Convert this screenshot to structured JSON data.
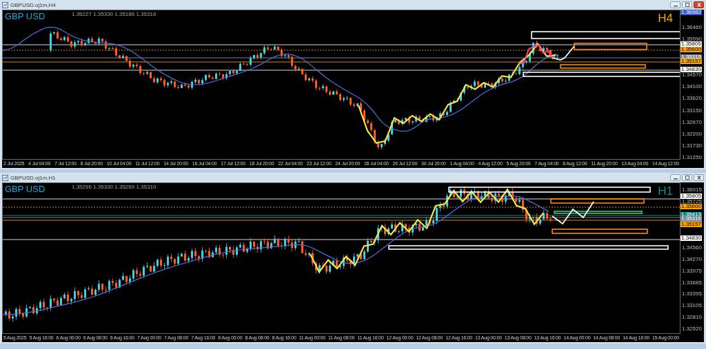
{
  "windows": [
    {
      "title": "GBPUSD.oj1m,H4",
      "active": true,
      "ohlc": "1.35227 1.35330 1.35186 1.35316",
      "symbol": "GBP USD",
      "timeframe": "H4",
      "price_scale": [
        "1.36460",
        "1.35990",
        "1.34570",
        "1.34100",
        "1.33620",
        "1.33150",
        "1.32670",
        "1.32200",
        "1.31730",
        "1.31250"
      ],
      "price_tags": [
        {
          "text": "1.36982",
          "color": "#2f5fd0"
        },
        {
          "text": "1.35805",
          "color": "#ffffff"
        },
        {
          "text": "1.35600",
          "color": "#f7a400"
        },
        {
          "text": "1.35315",
          "color": "#7a8794"
        },
        {
          "text": "1.35157",
          "color": "#f7a400"
        },
        {
          "text": "1.34830",
          "color": "#ffffff"
        }
      ],
      "time_labels": [
        "2 Jul 2025",
        "4 Jul 04:00",
        "7 Jul 12:00",
        "8 Jul 20:00",
        "10 Jul 04:00",
        "11 Jul 12:00",
        "14 Jul 20:00",
        "16 Jul 04:00",
        "17 Jul 12:00",
        "18 Jul 20:00",
        "22 Jul 04:00",
        "23 Jul 12:00",
        "24 Jul 20:00",
        "28 Jul 04:00",
        "29 Jul 12:00",
        "30 Jul 20:00",
        "1 Aug 04:00",
        "4 Aug 12:00",
        "5 Aug 20:00",
        "7 Aug 04:00",
        "8 Aug 12:00",
        "11 Aug 20:00",
        "13 Aug 04:00",
        "14 Aug 12:00"
      ]
    },
    {
      "title": "GBPUSD.oj1m,H1",
      "active": false,
      "ohlc": "1.35296 1.35330 1.35269 1.35310",
      "symbol": "GBP USD",
      "timeframe": "H1",
      "price_scale": [
        "1.36015",
        "1.35725",
        "1.34560",
        "1.34270",
        "1.33975",
        "1.33685",
        "1.33395",
        "1.33105",
        "1.32810",
        "1.32520"
      ],
      "price_tags": [
        {
          "text": "1.35805",
          "color": "#ffffff"
        },
        {
          "text": "1.35600",
          "color": "#f7a400"
        },
        {
          "text": "1.35413",
          "color": "#0f8a80"
        },
        {
          "text": "1.35315",
          "color": "#7a8794"
        },
        {
          "text": "1.35157",
          "color": "#f7a400"
        },
        {
          "text": "1.34830",
          "color": "#ffffff"
        }
      ],
      "time_labels": [
        "5 Aug 2025",
        "5 Aug 16:00",
        "6 Aug 00:00",
        "6 Aug 08:00",
        "6 Aug 16:00",
        "7 Aug 00:00",
        "7 Aug 08:00",
        "7 Aug 16:00",
        "8 Aug 00:00",
        "8 Aug 08:00",
        "8 Aug 16:00",
        "11 Aug 00:00",
        "11 Aug 08:00",
        "11 Aug 16:00",
        "12 Aug 00:00",
        "12 Aug 08:00",
        "12 Aug 16:00",
        "13 Aug 00:00",
        "13 Aug 08:00",
        "13 Aug 16:00",
        "14 Aug 00:00",
        "14 Aug 08:00",
        "14 Aug 16:00",
        "15 Aug 00:00"
      ]
    }
  ]
}
